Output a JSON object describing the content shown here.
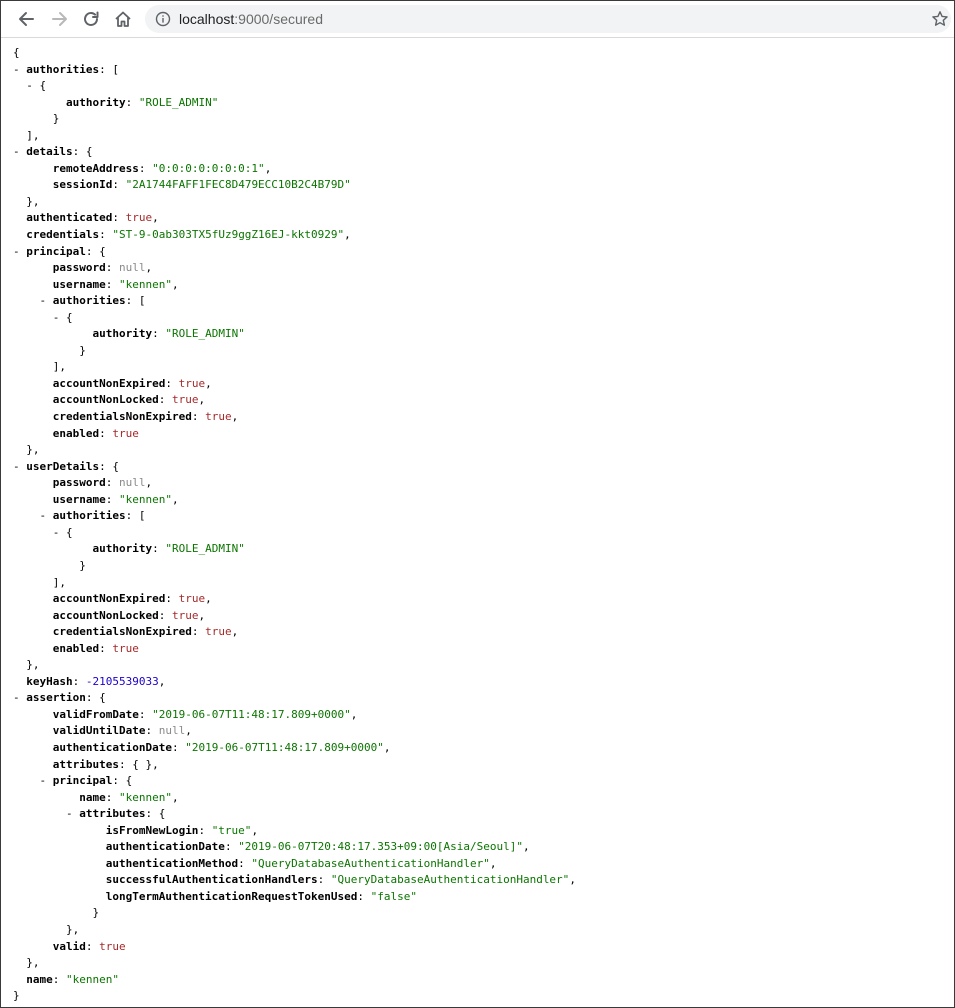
{
  "browser": {
    "url_host": "localhost",
    "url_rest": ":9000/secured",
    "icons": {
      "back": "arrow-left-icon",
      "forward": "arrow-right-icon",
      "reload": "reload-icon",
      "home": "home-icon",
      "site_info": "info-icon",
      "bookmark": "star-icon"
    }
  },
  "json_lines": [
    {
      "i": 0,
      "parts": [
        [
          "p",
          "{"
        ]
      ]
    },
    {
      "i": 1,
      "c": true,
      "parts": [
        [
          "k",
          "authorities"
        ],
        [
          "p",
          ": ["
        ]
      ]
    },
    {
      "i": 2,
      "c": true,
      "parts": [
        [
          "p",
          "{"
        ]
      ]
    },
    {
      "i": 4,
      "parts": [
        [
          "k",
          "authority"
        ],
        [
          "p",
          ": "
        ],
        [
          "s",
          "\"ROLE_ADMIN\""
        ]
      ]
    },
    {
      "i": 3,
      "parts": [
        [
          "p",
          "}"
        ]
      ]
    },
    {
      "i": 1,
      "parts": [
        [
          "p",
          "],"
        ]
      ]
    },
    {
      "i": 1,
      "c": true,
      "parts": [
        [
          "k",
          "details"
        ],
        [
          "p",
          ": {"
        ]
      ]
    },
    {
      "i": 3,
      "parts": [
        [
          "k",
          "remoteAddress"
        ],
        [
          "p",
          ": "
        ],
        [
          "s",
          "\"0:0:0:0:0:0:0:1\""
        ],
        [
          "p",
          ","
        ]
      ]
    },
    {
      "i": 3,
      "parts": [
        [
          "k",
          "sessionId"
        ],
        [
          "p",
          ": "
        ],
        [
          "s",
          "\"2A1744FAFF1FEC8D479ECC10B2C4B79D\""
        ]
      ]
    },
    {
      "i": 1,
      "parts": [
        [
          "p",
          "},"
        ]
      ]
    },
    {
      "i": 1,
      "parts": [
        [
          "k",
          "authenticated"
        ],
        [
          "p",
          ": "
        ],
        [
          "b",
          "true"
        ],
        [
          "p",
          ","
        ]
      ]
    },
    {
      "i": 1,
      "parts": [
        [
          "k",
          "credentials"
        ],
        [
          "p",
          ": "
        ],
        [
          "s",
          "\"ST-9-0ab303TX5fUz9ggZ16EJ-kkt0929\""
        ],
        [
          "p",
          ","
        ]
      ]
    },
    {
      "i": 1,
      "c": true,
      "parts": [
        [
          "k",
          "principal"
        ],
        [
          "p",
          ": {"
        ]
      ]
    },
    {
      "i": 3,
      "parts": [
        [
          "k",
          "password"
        ],
        [
          "p",
          ": "
        ],
        [
          "nl",
          "null"
        ],
        [
          "p",
          ","
        ]
      ]
    },
    {
      "i": 3,
      "parts": [
        [
          "k",
          "username"
        ],
        [
          "p",
          ": "
        ],
        [
          "s",
          "\"kennen\""
        ],
        [
          "p",
          ","
        ]
      ]
    },
    {
      "i": 3,
      "c": true,
      "parts": [
        [
          "k",
          "authorities"
        ],
        [
          "p",
          ": ["
        ]
      ]
    },
    {
      "i": 4,
      "c": true,
      "parts": [
        [
          "p",
          "{"
        ]
      ]
    },
    {
      "i": 6,
      "parts": [
        [
          "k",
          "authority"
        ],
        [
          "p",
          ": "
        ],
        [
          "s",
          "\"ROLE_ADMIN\""
        ]
      ]
    },
    {
      "i": 5,
      "parts": [
        [
          "p",
          "}"
        ]
      ]
    },
    {
      "i": 3,
      "parts": [
        [
          "p",
          "],"
        ]
      ]
    },
    {
      "i": 3,
      "parts": [
        [
          "k",
          "accountNonExpired"
        ],
        [
          "p",
          ": "
        ],
        [
          "b",
          "true"
        ],
        [
          "p",
          ","
        ]
      ]
    },
    {
      "i": 3,
      "parts": [
        [
          "k",
          "accountNonLocked"
        ],
        [
          "p",
          ": "
        ],
        [
          "b",
          "true"
        ],
        [
          "p",
          ","
        ]
      ]
    },
    {
      "i": 3,
      "parts": [
        [
          "k",
          "credentialsNonExpired"
        ],
        [
          "p",
          ": "
        ],
        [
          "b",
          "true"
        ],
        [
          "p",
          ","
        ]
      ]
    },
    {
      "i": 3,
      "parts": [
        [
          "k",
          "enabled"
        ],
        [
          "p",
          ": "
        ],
        [
          "b",
          "true"
        ]
      ]
    },
    {
      "i": 1,
      "parts": [
        [
          "p",
          "},"
        ]
      ]
    },
    {
      "i": 1,
      "c": true,
      "parts": [
        [
          "k",
          "userDetails"
        ],
        [
          "p",
          ": {"
        ]
      ]
    },
    {
      "i": 3,
      "parts": [
        [
          "k",
          "password"
        ],
        [
          "p",
          ": "
        ],
        [
          "nl",
          "null"
        ],
        [
          "p",
          ","
        ]
      ]
    },
    {
      "i": 3,
      "parts": [
        [
          "k",
          "username"
        ],
        [
          "p",
          ": "
        ],
        [
          "s",
          "\"kennen\""
        ],
        [
          "p",
          ","
        ]
      ]
    },
    {
      "i": 3,
      "c": true,
      "parts": [
        [
          "k",
          "authorities"
        ],
        [
          "p",
          ": ["
        ]
      ]
    },
    {
      "i": 4,
      "c": true,
      "parts": [
        [
          "p",
          "{"
        ]
      ]
    },
    {
      "i": 6,
      "parts": [
        [
          "k",
          "authority"
        ],
        [
          "p",
          ": "
        ],
        [
          "s",
          "\"ROLE_ADMIN\""
        ]
      ]
    },
    {
      "i": 5,
      "parts": [
        [
          "p",
          "}"
        ]
      ]
    },
    {
      "i": 3,
      "parts": [
        [
          "p",
          "],"
        ]
      ]
    },
    {
      "i": 3,
      "parts": [
        [
          "k",
          "accountNonExpired"
        ],
        [
          "p",
          ": "
        ],
        [
          "b",
          "true"
        ],
        [
          "p",
          ","
        ]
      ]
    },
    {
      "i": 3,
      "parts": [
        [
          "k",
          "accountNonLocked"
        ],
        [
          "p",
          ": "
        ],
        [
          "b",
          "true"
        ],
        [
          "p",
          ","
        ]
      ]
    },
    {
      "i": 3,
      "parts": [
        [
          "k",
          "credentialsNonExpired"
        ],
        [
          "p",
          ": "
        ],
        [
          "b",
          "true"
        ],
        [
          "p",
          ","
        ]
      ]
    },
    {
      "i": 3,
      "parts": [
        [
          "k",
          "enabled"
        ],
        [
          "p",
          ": "
        ],
        [
          "b",
          "true"
        ]
      ]
    },
    {
      "i": 1,
      "parts": [
        [
          "p",
          "},"
        ]
      ]
    },
    {
      "i": 1,
      "parts": [
        [
          "k",
          "keyHash"
        ],
        [
          "p",
          ": "
        ],
        [
          "n",
          "-2105539033"
        ],
        [
          "p",
          ","
        ]
      ]
    },
    {
      "i": 1,
      "c": true,
      "parts": [
        [
          "k",
          "assertion"
        ],
        [
          "p",
          ": {"
        ]
      ]
    },
    {
      "i": 3,
      "parts": [
        [
          "k",
          "validFromDate"
        ],
        [
          "p",
          ": "
        ],
        [
          "s",
          "\"2019-06-07T11:48:17.809+0000\""
        ],
        [
          "p",
          ","
        ]
      ]
    },
    {
      "i": 3,
      "parts": [
        [
          "k",
          "validUntilDate"
        ],
        [
          "p",
          ": "
        ],
        [
          "nl",
          "null"
        ],
        [
          "p",
          ","
        ]
      ]
    },
    {
      "i": 3,
      "parts": [
        [
          "k",
          "authenticationDate"
        ],
        [
          "p",
          ": "
        ],
        [
          "s",
          "\"2019-06-07T11:48:17.809+0000\""
        ],
        [
          "p",
          ","
        ]
      ]
    },
    {
      "i": 3,
      "parts": [
        [
          "k",
          "attributes"
        ],
        [
          "p",
          ": { },"
        ]
      ]
    },
    {
      "i": 3,
      "c": true,
      "parts": [
        [
          "k",
          "principal"
        ],
        [
          "p",
          ": {"
        ]
      ]
    },
    {
      "i": 5,
      "parts": [
        [
          "k",
          "name"
        ],
        [
          "p",
          ": "
        ],
        [
          "s",
          "\"kennen\""
        ],
        [
          "p",
          ","
        ]
      ]
    },
    {
      "i": 5,
      "c": true,
      "parts": [
        [
          "k",
          "attributes"
        ],
        [
          "p",
          ": {"
        ]
      ]
    },
    {
      "i": 7,
      "parts": [
        [
          "k",
          "isFromNewLogin"
        ],
        [
          "p",
          ": "
        ],
        [
          "s",
          "\"true\""
        ],
        [
          "p",
          ","
        ]
      ]
    },
    {
      "i": 7,
      "parts": [
        [
          "k",
          "authenticationDate"
        ],
        [
          "p",
          ": "
        ],
        [
          "s",
          "\"2019-06-07T20:48:17.353+09:00[Asia/Seoul]\""
        ],
        [
          "p",
          ","
        ]
      ]
    },
    {
      "i": 7,
      "parts": [
        [
          "k",
          "authenticationMethod"
        ],
        [
          "p",
          ": "
        ],
        [
          "s",
          "\"QueryDatabaseAuthenticationHandler\""
        ],
        [
          "p",
          ","
        ]
      ]
    },
    {
      "i": 7,
      "parts": [
        [
          "k",
          "successfulAuthenticationHandlers"
        ],
        [
          "p",
          ": "
        ],
        [
          "s",
          "\"QueryDatabaseAuthenticationHandler\""
        ],
        [
          "p",
          ","
        ]
      ]
    },
    {
      "i": 7,
      "parts": [
        [
          "k",
          "longTermAuthenticationRequestTokenUsed"
        ],
        [
          "p",
          ": "
        ],
        [
          "s",
          "\"false\""
        ]
      ]
    },
    {
      "i": 6,
      "parts": [
        [
          "p",
          "}"
        ]
      ]
    },
    {
      "i": 4,
      "parts": [
        [
          "p",
          "},"
        ]
      ]
    },
    {
      "i": 3,
      "parts": [
        [
          "k",
          "valid"
        ],
        [
          "p",
          ": "
        ],
        [
          "b",
          "true"
        ]
      ]
    },
    {
      "i": 1,
      "parts": [
        [
          "p",
          "},"
        ]
      ]
    },
    {
      "i": 1,
      "parts": [
        [
          "k",
          "name"
        ],
        [
          "p",
          ": "
        ],
        [
          "s",
          "\"kennen\""
        ]
      ]
    },
    {
      "i": 0,
      "parts": [
        [
          "p",
          "}"
        ]
      ]
    }
  ]
}
